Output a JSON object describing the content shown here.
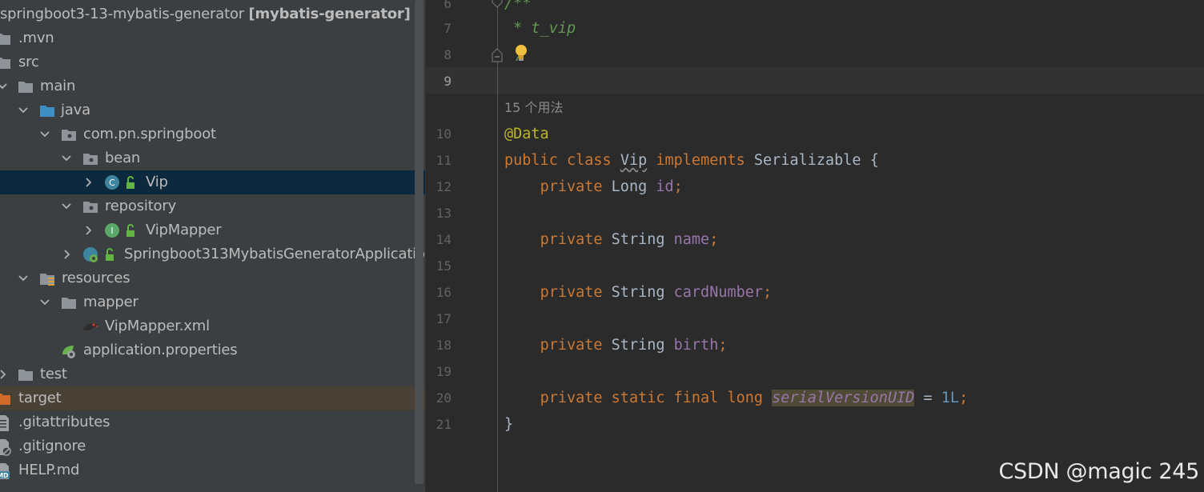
{
  "tree": {
    "root": {
      "name": "springboot3-13-mybatis-generator",
      "module": "[mybatis-generator]"
    },
    "items": [
      {
        "label": ".mvn"
      },
      {
        "label": "src"
      },
      {
        "label": "main"
      },
      {
        "label": "java"
      },
      {
        "label": "com.pn.springboot"
      },
      {
        "label": "bean"
      },
      {
        "label": "Vip"
      },
      {
        "label": "repository"
      },
      {
        "label": "VipMapper"
      },
      {
        "label": "Springboot313MybatisGeneratorApplicatio"
      },
      {
        "label": "resources"
      },
      {
        "label": "mapper"
      },
      {
        "label": "VipMapper.xml"
      },
      {
        "label": "application.properties"
      },
      {
        "label": "test"
      },
      {
        "label": "target"
      },
      {
        "label": ".gitattributes"
      },
      {
        "label": ".gitignore"
      },
      {
        "label": "HELP.md"
      }
    ],
    "class_badge": "C",
    "interface_badge": "I",
    "md_badge": "MD"
  },
  "editor": {
    "line_numbers": [
      "6",
      "7",
      "8",
      "9",
      "10",
      "11",
      "12",
      "13",
      "14",
      "15",
      "16",
      "17",
      "18",
      "19",
      "20",
      "21"
    ],
    "usages": "15 个用法",
    "doc_open": "/**",
    "doc_text": " * t_vip",
    "doc_close": "/",
    "annotation": "@Data",
    "class_decl": {
      "kw1": "public",
      "kw2": "class",
      "name": "Vip",
      "kw3": "implements",
      "iface": "Serializable",
      "brace": "{"
    },
    "fields": [
      {
        "modifiers": "private",
        "type": "Long",
        "name": "id",
        "end": ";"
      },
      {
        "modifiers": "private",
        "type": "String",
        "name": "name",
        "end": ";"
      },
      {
        "modifiers": "private",
        "type": "String",
        "name": "cardNumber",
        "end": ";"
      },
      {
        "modifiers": "private",
        "type": "String",
        "name": "birth",
        "end": ";"
      }
    ],
    "serial": {
      "modifiers": "private static final long",
      "name": "serialVersionUID",
      "assign": " = ",
      "value": "1L",
      "end": ";"
    },
    "close_brace": "}"
  },
  "watermark": "CSDN @magic 245",
  "colors": {
    "keyword": "#cc7832",
    "annotation": "#bbb529",
    "field": "#9876aa",
    "number": "#6897bb",
    "doc_comment": "#629755",
    "selection": "#0d293e"
  }
}
